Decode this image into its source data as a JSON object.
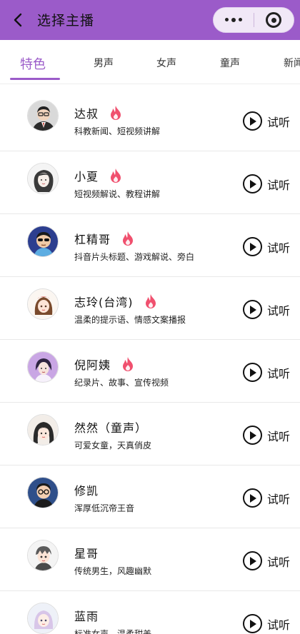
{
  "header": {
    "title": "选择主播",
    "back_icon": "chevron-left-icon",
    "more_icon": "more-dots-icon",
    "close_icon": "target-ring-icon",
    "bar_color": "#9b5bc9"
  },
  "tabs": [
    {
      "label": "特色",
      "active": true
    },
    {
      "label": "男声",
      "active": false
    },
    {
      "label": "女声",
      "active": false
    },
    {
      "label": "童声",
      "active": false
    },
    {
      "label": "新闻",
      "active": false
    }
  ],
  "accent_color": "#9b5bc9",
  "flame_color": "#f0506e",
  "listen_label": "试听",
  "anchors": [
    {
      "name": "达叔",
      "desc": "科教新闻、短视频讲解",
      "hot": true,
      "avatar": "suit-man-avatar"
    },
    {
      "name": "小夏",
      "desc": "短视频解说、教程讲解",
      "hot": true,
      "avatar": "girl-sketch-avatar"
    },
    {
      "name": "杠精哥",
      "desc": "抖音片头标题、游戏解说、旁白",
      "hot": true,
      "avatar": "sunglasses-man-avatar"
    },
    {
      "name": "志玲(台湾)",
      "desc": "温柔的提示语、情感文案播报",
      "hot": true,
      "avatar": "anime-girl-avatar"
    },
    {
      "name": "倪阿姨",
      "desc": "纪录片、故事、宣传视频",
      "hot": true,
      "avatar": "lady-purple-avatar"
    },
    {
      "name": "然然（童声）",
      "desc": "可爱女童，天真俏皮",
      "hot": false,
      "avatar": "child-girl-avatar"
    },
    {
      "name": "修凯",
      "desc": "浑厚低沉帝王音",
      "hot": false,
      "avatar": "glasses-boy-avatar"
    },
    {
      "name": "星哥",
      "desc": "传统男生，风趣幽默",
      "hot": false,
      "avatar": "anime-boy-avatar"
    },
    {
      "name": "蓝雨",
      "desc": "标准女声，温柔甜美",
      "hot": false,
      "avatar": "pastel-girl-avatar"
    }
  ]
}
